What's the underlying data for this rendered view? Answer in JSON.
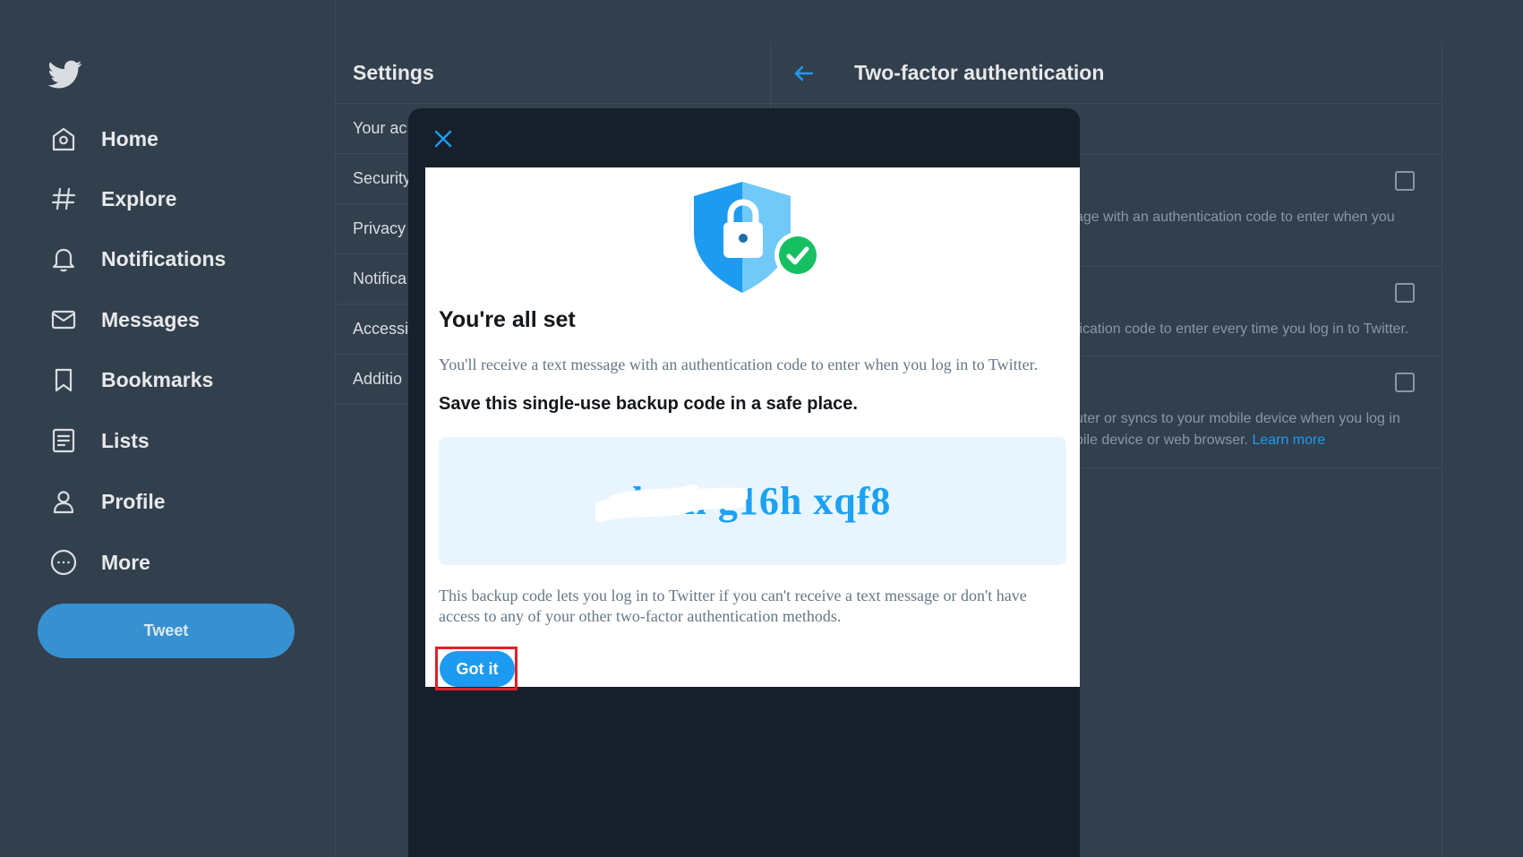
{
  "sidebar": {
    "items": [
      {
        "label": "Home",
        "icon": "home-icon"
      },
      {
        "label": "Explore",
        "icon": "hashtag-icon"
      },
      {
        "label": "Notifications",
        "icon": "bell-icon"
      },
      {
        "label": "Messages",
        "icon": "envelope-icon"
      },
      {
        "label": "Bookmarks",
        "icon": "bookmark-icon"
      },
      {
        "label": "Lists",
        "icon": "list-icon"
      },
      {
        "label": "Profile",
        "icon": "person-icon"
      },
      {
        "label": "More",
        "icon": "more-icon"
      }
    ],
    "tweet_label": "Tweet"
  },
  "settings": {
    "title": "Settings",
    "items": [
      {
        "label": "Your ac"
      },
      {
        "label": "Security"
      },
      {
        "label": "Privacy"
      },
      {
        "label": "Notifica"
      },
      {
        "label": "Accessil"
      },
      {
        "label": "Additio"
      }
    ]
  },
  "tfa": {
    "title": "Two-factor authentication",
    "rows": [
      {
        "desc1": "age with an authentication code to enter when you",
        "desc2": ""
      },
      {
        "desc1": "fication code to enter every time you log in to Twitter.",
        "desc2": ""
      },
      {
        "desc1": "uter or syncs to your mobile device when you log in",
        "desc2": "pile device or web browser.",
        "link": "Learn more"
      }
    ]
  },
  "modal": {
    "title": "You're all set",
    "subtitle": "You'll receive a text message with an authentication code to enter when you log in to Twitter.",
    "save_heading": "Save this single-use backup code in a safe place.",
    "backup_code": "zkwn g16h xqf8",
    "note": "This backup code lets you log in to Twitter if you can't receive a text message or don't have access to any of your other two-factor authentication methods.",
    "got_it_label": "Got it"
  },
  "colors": {
    "background": "#323f4d",
    "modal_dark": "#16202b",
    "accent": "#1d9bf0",
    "tweet_button": "#3791d0",
    "highlight_frame": "#e0202a",
    "code_box": "#e8f5fe"
  }
}
